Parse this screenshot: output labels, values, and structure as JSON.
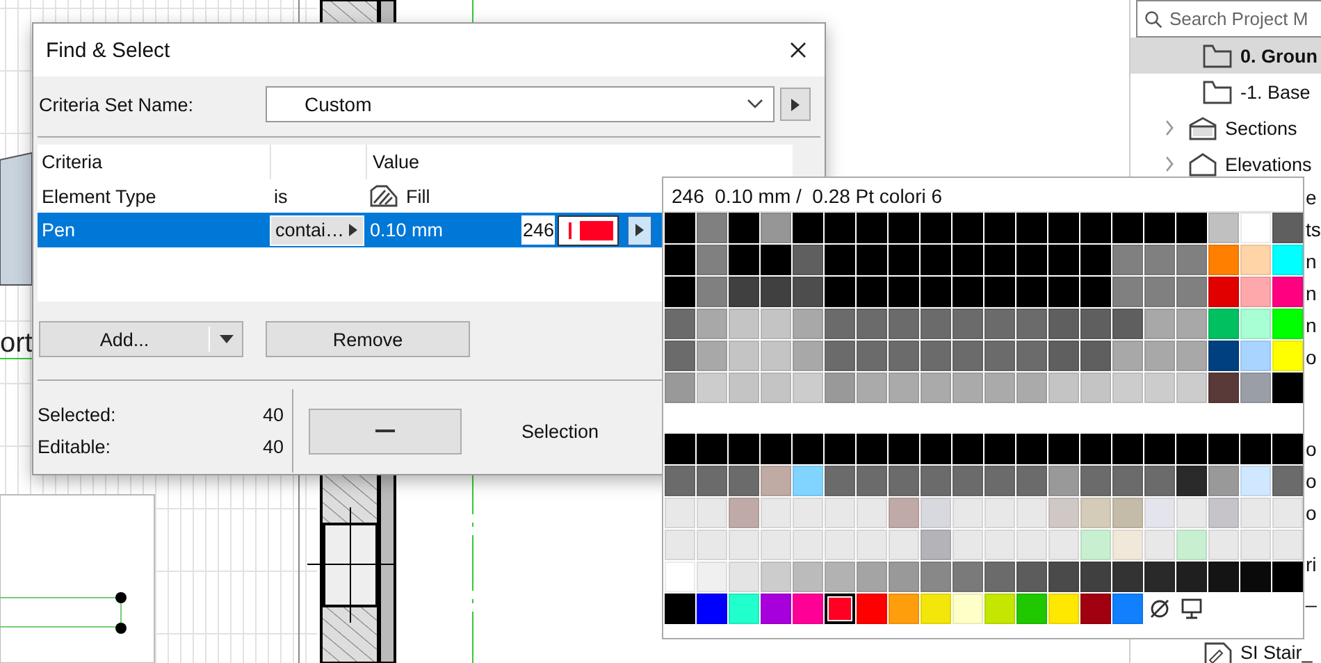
{
  "canvas": {
    "label": "ort"
  },
  "sidebar": {
    "search": {
      "placeholder": "Search Project M"
    },
    "items": [
      {
        "label": "0. Groun",
        "kind": "view",
        "selected": true
      },
      {
        "label": "-1. Base",
        "kind": "view",
        "selected": false
      },
      {
        "label": "Sections",
        "kind": "section",
        "expanded": false,
        "selected": false
      },
      {
        "label": "Elevations",
        "kind": "elevation",
        "expanded": false,
        "selected": false
      }
    ],
    "clipped_labels": [
      "e",
      "ts",
      "n",
      "n",
      "n",
      "o",
      "o",
      "o",
      "o",
      "ri",
      "_"
    ],
    "last_item": {
      "label": "SI Stair_",
      "kind": "document"
    }
  },
  "dialog": {
    "title": "Find & Select",
    "criteria_set": {
      "label": "Criteria Set Name:",
      "value": "Custom"
    },
    "columns": [
      "Criteria",
      "Value"
    ],
    "rows": [
      {
        "criteria": "Element Type",
        "operator": {
          "kind": "text",
          "text": "is"
        },
        "value": {
          "kind": "element",
          "text": "Fill"
        },
        "selected": false
      },
      {
        "criteria": "Pen",
        "operator": {
          "kind": "button",
          "text": "contai…"
        },
        "value": {
          "kind": "pen",
          "text": "0.10 mm",
          "number": "246",
          "color": "#ff0022"
        },
        "selected": true
      }
    ],
    "buttons": {
      "add": "Add...",
      "remove": "Remove"
    },
    "stats": [
      {
        "label": "Selected:",
        "value": "40"
      },
      {
        "label": "Editable:",
        "value": "40"
      }
    ],
    "selection_label": "Selection"
  },
  "palette": {
    "header": "246  0.10 mm /  0.28 Pt colori 6",
    "top_rows": [
      [
        {
          "color": "#000000",
          "selected": false
        },
        {
          "color": "#808080",
          "selected": false
        },
        {
          "color": "#000000",
          "selected": false
        },
        {
          "color": "#969696",
          "selected": false
        },
        {
          "color": "#000000",
          "selected": false
        },
        {
          "color": "#000000",
          "selected": false
        },
        {
          "color": "#000000",
          "selected": false
        },
        {
          "color": "#000000",
          "selected": false
        },
        {
          "color": "#000000",
          "selected": false
        },
        {
          "color": "#000000",
          "selected": false
        },
        {
          "color": "#000000",
          "selected": false
        },
        {
          "color": "#000000",
          "selected": false
        },
        {
          "color": "#000000",
          "selected": false
        },
        {
          "color": "#000000",
          "selected": false
        },
        {
          "color": "#000000",
          "selected": false
        },
        {
          "color": "#000000",
          "selected": false
        },
        {
          "color": "#000000",
          "selected": false
        },
        {
          "color": "#c0c0c0",
          "selected": false
        },
        {
          "color": "#ffffff",
          "selected": false
        },
        {
          "color": "#5f5f5f",
          "selected": false
        }
      ],
      [
        {
          "color": "#000000",
          "selected": false
        },
        {
          "color": "#808080",
          "selected": false
        },
        {
          "color": "#000000",
          "selected": false
        },
        {
          "color": "#000000",
          "selected": false
        },
        {
          "color": "#5f5f5f",
          "selected": false
        },
        {
          "color": "#000000",
          "selected": false
        },
        {
          "color": "#000000",
          "selected": false
        },
        {
          "color": "#000000",
          "selected": false
        },
        {
          "color": "#000000",
          "selected": false
        },
        {
          "color": "#000000",
          "selected": false
        },
        {
          "color": "#000000",
          "selected": false
        },
        {
          "color": "#000000",
          "selected": false
        },
        {
          "color": "#000000",
          "selected": false
        },
        {
          "color": "#000000",
          "selected": false
        },
        {
          "color": "#808080",
          "selected": false
        },
        {
          "color": "#808080",
          "selected": false
        },
        {
          "color": "#808080",
          "selected": false
        },
        {
          "color": "#ff8000",
          "selected": false
        },
        {
          "color": "#ffd5a8",
          "selected": false
        },
        {
          "color": "#00ffff",
          "selected": false
        }
      ],
      [
        {
          "color": "#000000",
          "selected": false
        },
        {
          "color": "#808080",
          "selected": false
        },
        {
          "color": "#404040",
          "selected": false
        },
        {
          "color": "#404040",
          "selected": false
        },
        {
          "color": "#4d4d4d",
          "selected": false
        },
        {
          "color": "#000000",
          "selected": false
        },
        {
          "color": "#000000",
          "selected": false
        },
        {
          "color": "#000000",
          "selected": false
        },
        {
          "color": "#000000",
          "selected": false
        },
        {
          "color": "#000000",
          "selected": false
        },
        {
          "color": "#000000",
          "selected": false
        },
        {
          "color": "#000000",
          "selected": false
        },
        {
          "color": "#000000",
          "selected": false
        },
        {
          "color": "#000000",
          "selected": false
        },
        {
          "color": "#808080",
          "selected": false
        },
        {
          "color": "#808080",
          "selected": false
        },
        {
          "color": "#808080",
          "selected": false
        },
        {
          "color": "#e00000",
          "selected": false
        },
        {
          "color": "#ffa8ac",
          "selected": false
        },
        {
          "color": "#ff0080",
          "selected": false
        }
      ],
      [
        {
          "color": "#6b6b6b",
          "selected": false
        },
        {
          "color": "#a8a8a8",
          "selected": false
        },
        {
          "color": "#c4c4c4",
          "selected": false
        },
        {
          "color": "#c4c4c4",
          "selected": false
        },
        {
          "color": "#a8a8a8",
          "selected": false
        },
        {
          "color": "#6b6b6b",
          "selected": false
        },
        {
          "color": "#6b6b6b",
          "selected": false
        },
        {
          "color": "#6b6b6b",
          "selected": false
        },
        {
          "color": "#6b6b6b",
          "selected": false
        },
        {
          "color": "#6b6b6b",
          "selected": false
        },
        {
          "color": "#6b6b6b",
          "selected": false
        },
        {
          "color": "#6b6b6b",
          "selected": false
        },
        {
          "color": "#5f5f5f",
          "selected": false
        },
        {
          "color": "#5f5f5f",
          "selected": false
        },
        {
          "color": "#5f5f5f",
          "selected": false
        },
        {
          "color": "#a8a8a8",
          "selected": false
        },
        {
          "color": "#a8a8a8",
          "selected": false
        },
        {
          "color": "#00c060",
          "selected": false
        },
        {
          "color": "#a8ffd4",
          "selected": false
        },
        {
          "color": "#00ff00",
          "selected": false
        }
      ],
      [
        {
          "color": "#6b6b6b",
          "selected": false
        },
        {
          "color": "#a8a8a8",
          "selected": false
        },
        {
          "color": "#c4c4c4",
          "selected": false
        },
        {
          "color": "#c4c4c4",
          "selected": false
        },
        {
          "color": "#a8a8a8",
          "selected": false
        },
        {
          "color": "#6b6b6b",
          "selected": false
        },
        {
          "color": "#6b6b6b",
          "selected": false
        },
        {
          "color": "#6b6b6b",
          "selected": false
        },
        {
          "color": "#6b6b6b",
          "selected": false
        },
        {
          "color": "#6b6b6b",
          "selected": false
        },
        {
          "color": "#6b6b6b",
          "selected": false
        },
        {
          "color": "#6b6b6b",
          "selected": false
        },
        {
          "color": "#5f5f5f",
          "selected": false
        },
        {
          "color": "#5f5f5f",
          "selected": false
        },
        {
          "color": "#a8a8a8",
          "selected": false
        },
        {
          "color": "#a8a8a8",
          "selected": false
        },
        {
          "color": "#a8a8a8",
          "selected": false
        },
        {
          "color": "#004080",
          "selected": false
        },
        {
          "color": "#a8d4ff",
          "selected": false
        },
        {
          "color": "#ffff00",
          "selected": false
        }
      ],
      [
        {
          "color": "#999999",
          "selected": false
        },
        {
          "color": "#cccccc",
          "selected": false
        },
        {
          "color": "#c4c4c4",
          "selected": false
        },
        {
          "color": "#c4c4c4",
          "selected": false
        },
        {
          "color": "#cccccc",
          "selected": false
        },
        {
          "color": "#999999",
          "selected": false
        },
        {
          "color": "#aaaaaa",
          "selected": false
        },
        {
          "color": "#aaaaaa",
          "selected": false
        },
        {
          "color": "#aaaaaa",
          "selected": false
        },
        {
          "color": "#aaaaaa",
          "selected": false
        },
        {
          "color": "#aaaaaa",
          "selected": false
        },
        {
          "color": "#aaaaaa",
          "selected": false
        },
        {
          "color": "#c4c4c4",
          "selected": false
        },
        {
          "color": "#c4c4c4",
          "selected": false
        },
        {
          "color": "#cccccc",
          "selected": false
        },
        {
          "color": "#cccccc",
          "selected": false
        },
        {
          "color": "#cccccc",
          "selected": false
        },
        {
          "color": "#5a3a38",
          "selected": false
        },
        {
          "color": "#9a9ea6",
          "selected": false
        },
        {
          "color": "#000000",
          "selected": false
        }
      ]
    ],
    "bottom_rows": [
      [
        {
          "color": "#000000",
          "selected": false
        },
        {
          "color": "#000000",
          "selected": false
        },
        {
          "color": "#000000",
          "selected": false
        },
        {
          "color": "#000000",
          "selected": false
        },
        {
          "color": "#000000",
          "selected": false
        },
        {
          "color": "#000000",
          "selected": false
        },
        {
          "color": "#000000",
          "selected": false
        },
        {
          "color": "#000000",
          "selected": false
        },
        {
          "color": "#000000",
          "selected": false
        },
        {
          "color": "#000000",
          "selected": false
        },
        {
          "color": "#000000",
          "selected": false
        },
        {
          "color": "#000000",
          "selected": false
        },
        {
          "color": "#000000",
          "selected": false
        },
        {
          "color": "#000000",
          "selected": false
        },
        {
          "color": "#000000",
          "selected": false
        },
        {
          "color": "#000000",
          "selected": false
        },
        {
          "color": "#000000",
          "selected": false
        },
        {
          "color": "#000000",
          "selected": false
        },
        {
          "color": "#000000",
          "selected": false
        },
        {
          "color": "#000000",
          "selected": false
        }
      ],
      [
        {
          "color": "#6b6b6b",
          "selected": false
        },
        {
          "color": "#6b6b6b",
          "selected": false
        },
        {
          "color": "#6b6b6b",
          "selected": false
        },
        {
          "color": "#c0aaa4",
          "selected": false
        },
        {
          "color": "#80d4ff",
          "selected": false
        },
        {
          "color": "#6b6b6b",
          "selected": false
        },
        {
          "color": "#6b6b6b",
          "selected": false
        },
        {
          "color": "#6b6b6b",
          "selected": false
        },
        {
          "color": "#6b6b6b",
          "selected": false
        },
        {
          "color": "#6b6b6b",
          "selected": false
        },
        {
          "color": "#6b6b6b",
          "selected": false
        },
        {
          "color": "#6b6b6b",
          "selected": false
        },
        {
          "color": "#999999",
          "selected": false
        },
        {
          "color": "#6b6b6b",
          "selected": false
        },
        {
          "color": "#6b6b6b",
          "selected": false
        },
        {
          "color": "#6b6b6b",
          "selected": false
        },
        {
          "color": "#2a2a2a",
          "selected": false
        },
        {
          "color": "#999999",
          "selected": false
        },
        {
          "color": "#d0e8ff",
          "selected": false
        },
        {
          "color": "#6b6b6b",
          "selected": false
        }
      ],
      [
        {
          "color": "#e8e8e8",
          "selected": false
        },
        {
          "color": "#e8e8e8",
          "selected": false
        },
        {
          "color": "#c0aaa8",
          "selected": false
        },
        {
          "color": "#e8e8e8",
          "selected": false
        },
        {
          "color": "#e8e8e8",
          "selected": false
        },
        {
          "color": "#e8e8e8",
          "selected": false
        },
        {
          "color": "#e8e8e8",
          "selected": false
        },
        {
          "color": "#c0aaa8",
          "selected": false
        },
        {
          "color": "#d8d9de",
          "selected": false
        },
        {
          "color": "#e8e8e8",
          "selected": false
        },
        {
          "color": "#e8e8e8",
          "selected": false
        },
        {
          "color": "#e8e8e8",
          "selected": false
        },
        {
          "color": "#d0c8c4",
          "selected": false
        },
        {
          "color": "#d4ccb8",
          "selected": false
        },
        {
          "color": "#c4bca8",
          "selected": false
        },
        {
          "color": "#e4e4ec",
          "selected": false
        },
        {
          "color": "#e8e8e8",
          "selected": false
        },
        {
          "color": "#c6c4c8",
          "selected": false
        },
        {
          "color": "#e8e8e8",
          "selected": false
        },
        {
          "color": "#e8e8e8",
          "selected": false
        }
      ],
      [
        {
          "color": "#e8e8e8",
          "selected": false
        },
        {
          "color": "#e8e8e8",
          "selected": false
        },
        {
          "color": "#e8e8e8",
          "selected": false
        },
        {
          "color": "#e8e8e8",
          "selected": false
        },
        {
          "color": "#e8e8e8",
          "selected": false
        },
        {
          "color": "#e8e8e8",
          "selected": false
        },
        {
          "color": "#e8e8e8",
          "selected": false
        },
        {
          "color": "#e8e8e8",
          "selected": false
        },
        {
          "color": "#b4b4b8",
          "selected": false
        },
        {
          "color": "#e8e8e8",
          "selected": false
        },
        {
          "color": "#e8e8e8",
          "selected": false
        },
        {
          "color": "#e8e8e8",
          "selected": false
        },
        {
          "color": "#e8e8e8",
          "selected": false
        },
        {
          "color": "#c8f0d0",
          "selected": false
        },
        {
          "color": "#f0e8d8",
          "selected": false
        },
        {
          "color": "#e8e8e8",
          "selected": false
        },
        {
          "color": "#c8f0d0",
          "selected": false
        },
        {
          "color": "#e8e8e8",
          "selected": false
        },
        {
          "color": "#e8e8e8",
          "selected": false
        },
        {
          "color": "#e8e8e8",
          "selected": false
        }
      ],
      [
        {
          "color": "#ffffff",
          "selected": false
        },
        {
          "color": "#f0f0f0",
          "selected": false
        },
        {
          "color": "#e4e4e4",
          "selected": false
        },
        {
          "color": "#cccccc",
          "selected": false
        },
        {
          "color": "#bbbbbb",
          "selected": false
        },
        {
          "color": "#b2b2b2",
          "selected": false
        },
        {
          "color": "#a4a4a4",
          "selected": false
        },
        {
          "color": "#999999",
          "selected": false
        },
        {
          "color": "#888888",
          "selected": false
        },
        {
          "color": "#7a7a7a",
          "selected": false
        },
        {
          "color": "#6b6b6b",
          "selected": false
        },
        {
          "color": "#5c5c5c",
          "selected": false
        },
        {
          "color": "#4a4a4a",
          "selected": false
        },
        {
          "color": "#404040",
          "selected": false
        },
        {
          "color": "#333333",
          "selected": false
        },
        {
          "color": "#292929",
          "selected": false
        },
        {
          "color": "#1f1f1f",
          "selected": false
        },
        {
          "color": "#141414",
          "selected": false
        },
        {
          "color": "#0a0a0a",
          "selected": false
        },
        {
          "color": "#000000",
          "selected": false
        }
      ],
      [
        {
          "color": "#000000",
          "selected": false
        },
        {
          "color": "#0000ff",
          "selected": false
        },
        {
          "color": "#20ffcc",
          "selected": false
        },
        {
          "color": "#a800dc",
          "selected": false
        },
        {
          "color": "#ff0096",
          "selected": false
        },
        {
          "color": "#ff0022",
          "selected": true
        },
        {
          "color": "#ff0000",
          "selected": false
        },
        {
          "color": "#ff9e0c",
          "selected": false
        },
        {
          "color": "#f2e60a",
          "selected": false
        },
        {
          "color": "#ffffc8",
          "selected": false
        },
        {
          "color": "#c4e600",
          "selected": false
        },
        {
          "color": "#20c800",
          "selected": false
        },
        {
          "color": "#ffe800",
          "selected": false
        },
        {
          "color": "#a00010",
          "selected": false
        },
        {
          "color": "#1080ff",
          "selected": false
        }
      ]
    ]
  }
}
